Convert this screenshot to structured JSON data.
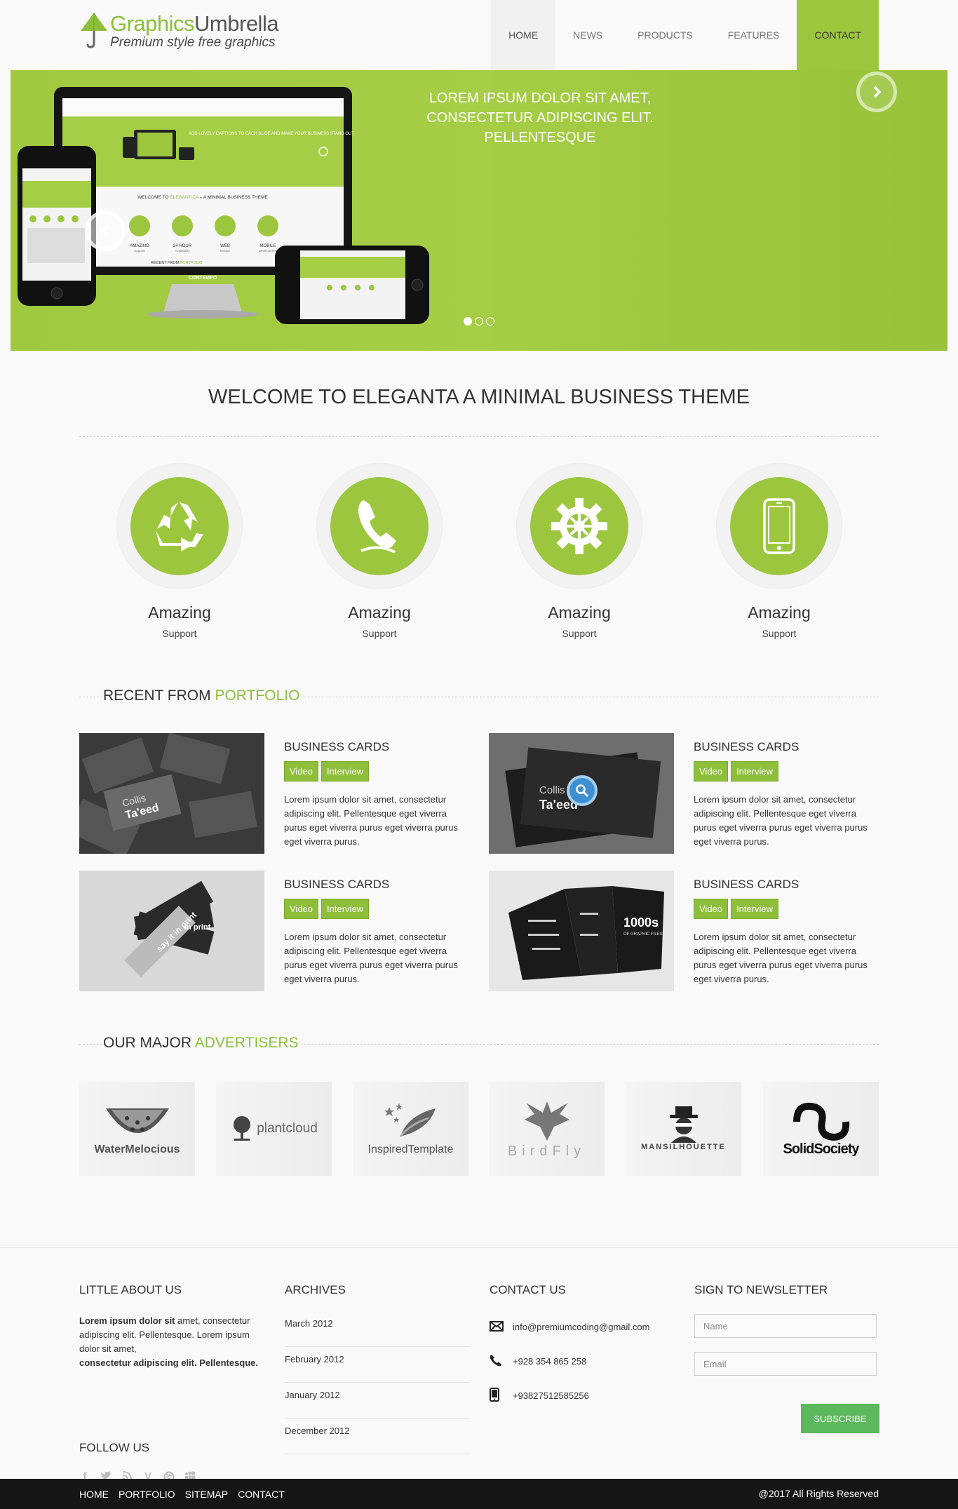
{
  "brand": {
    "name_part1": "Graphics",
    "name_part2": "Umbrella",
    "tagline": "Premium style free graphics"
  },
  "nav": {
    "items": [
      "HOME",
      "NEWS",
      "PRODUCTS",
      "FEATURES",
      "CONTACT"
    ],
    "active": "CONTACT"
  },
  "slider": {
    "caption": "LOREM IPSUM DOLOR SIT AMET, CONSECTETUR ADIPISCING ELIT. PELLENTESQUE",
    "slide_count": 3,
    "current_slide": 1,
    "mockup": {
      "screen_caption": "ADD LOVELY CAPTIONS TO EACH SLIDE AND MAKE YOUR BUSINESS STAND OUT",
      "welcome_prefix": "WELCOME TO",
      "welcome_brand": "ELEGANTICA",
      "welcome_suffix": "– A MINIMAL BUSINESS THEME",
      "features": [
        "AMAZING",
        "24 HOUR",
        "WEB",
        "MOBILE"
      ],
      "feature_subs": [
        "Support",
        "Availability",
        "Design",
        "Development"
      ],
      "recent_prefix": "RECENT FROM",
      "recent_hl": "PORTFOLIO",
      "monitor_label": "CONTEMPO"
    }
  },
  "welcome": {
    "title": "WELCOME TO ELEGANTA A MINIMAL BUSINESS THEME"
  },
  "features": [
    {
      "title": "Amazing",
      "sub": "Support",
      "icon": "recycle-icon"
    },
    {
      "title": "Amazing",
      "sub": "Support",
      "icon": "phone-icon"
    },
    {
      "title": "Amazing",
      "sub": "Support",
      "icon": "gear-icon"
    },
    {
      "title": "Amazing",
      "sub": "Support",
      "icon": "mobile-icon"
    }
  ],
  "portfolio": {
    "heading": "RECENT FROM",
    "heading_hl": "PORTFOLIO",
    "items": [
      {
        "title": "BUSINESS CARDS",
        "btn1": "Video",
        "btn2": "Interview",
        "text": "Lorem ipsum dolor sit amet, consectetur adipiscing elit. Pellentesque eget viverra purus eget viverra purus eget viverra purus eget viverra purus."
      },
      {
        "title": "BUSINESS CARDS",
        "btn1": "Video",
        "btn2": "Interview",
        "text": "Lorem ipsum dolor sit amet, consectetur adipiscing elit. Pellentesque eget viverra purus eget viverra purus eget viverra purus eget viverra purus."
      },
      {
        "title": "BUSINESS CARDS",
        "btn1": "Video",
        "btn2": "Interview",
        "text": "Lorem ipsum dolor sit amet, consectetur adipiscing elit. Pellentesque eget viverra purus eget viverra purus eget viverra purus eget viverra purus."
      },
      {
        "title": "BUSINESS CARDS",
        "btn1": "Video",
        "btn2": "Interview",
        "text": "Lorem ipsum dolor sit amet, consectetur adipiscing elit. Pellentesque eget viverra purus eget viverra purus eget viverra purus eget viverra purus."
      }
    ],
    "thumb_text": {
      "card_name_1": "Collis",
      "card_name_2": "Ta'eed",
      "fan_1": "say it in print",
      "fan_2": "in print",
      "brochure_big": "1000s",
      "brochure_sub": "OF GRAPHIC FILES"
    }
  },
  "advertisers": {
    "heading": "OUR MAJOR",
    "heading_hl": "ADVERTISERS",
    "logos": [
      "WaterMelocious",
      "plantcloud",
      "InspiredTemplate",
      "BirdFly",
      "MANSILHOUETTE",
      "SolidSociety"
    ]
  },
  "footer": {
    "about": {
      "heading": "LITTLE ABOUT US",
      "p1_bold": "Lorem ipsum dolor sit",
      "p1_rest": " amet, consectetur adipiscing elit. Pellentesque. Lorem ipsum dolor sit amet,",
      "p2_bold": "consectetur adipiscing elit. Pellentesque."
    },
    "follow": {
      "heading": "FOLLOW US",
      "icons": [
        "facebook-icon",
        "twitter-icon",
        "rss-icon",
        "vimeo-icon",
        "dribbble-icon",
        "myspace-icon"
      ]
    },
    "archives": {
      "heading": "ARCHIVES",
      "items": [
        "March 2012",
        "February 2012",
        "January 2012",
        "December 2012"
      ]
    },
    "contact": {
      "heading": "CONTACT US",
      "email": "info@premiumcoding@gmail.com",
      "phone": "+928 354 865 258",
      "mobile": "+93827512585256"
    },
    "newsletter": {
      "heading": "SIGN TO NEWSLETTER",
      "name_placeholder": "Name",
      "email_placeholder": "Email",
      "button": "SUBSCRIBE"
    }
  },
  "bottombar": {
    "links": [
      "HOME",
      "PORTFOLIO",
      "SITEMAP",
      "CONTACT"
    ],
    "copyright": "@2017 All Rights Reserved"
  },
  "colors": {
    "accent": "#9dc63f",
    "accent_dark": "#8dbf3a",
    "subscribe": "#5cb85c",
    "bottombar": "#161616"
  }
}
